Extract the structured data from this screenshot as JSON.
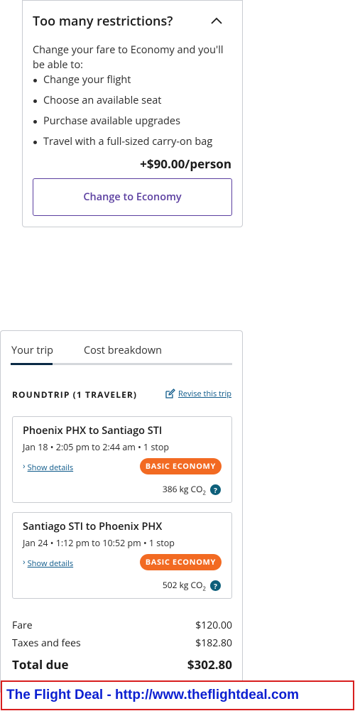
{
  "restrictions": {
    "title": "Too many restrictions?",
    "intro": "Change your fare to Economy and you'll be able to:",
    "items": [
      "Change your flight",
      "Choose an available seat",
      "Purchase available upgrades",
      "Travel with a full-sized carry-on bag"
    ],
    "price": "+$90.00/person",
    "button_label": "Change to Economy"
  },
  "trip": {
    "tabs": [
      {
        "label": "Your trip",
        "active": true
      },
      {
        "label": "Cost breakdown",
        "active": false
      }
    ],
    "trip_type_label": "ROUNDTRIP (1 TRAVELER)",
    "revise_label": "Revise this trip",
    "flights": [
      {
        "route": "Phoenix PHX to Santiago STI",
        "times": "Jan 18 • 2:05 pm to 2:44 am • 1 stop",
        "details_label": "Show details",
        "fare_badge": "BASIC ECONOMY",
        "co2_value": "386 kg CO",
        "co2_sub": "2"
      },
      {
        "route": "Santiago STI to Phoenix PHX",
        "times": "Jan 24 • 1:12 pm to 10:52 pm • 1 stop",
        "details_label": "Show details",
        "fare_badge": "BASIC ECONOMY",
        "co2_value": "502 kg CO",
        "co2_sub": "2"
      }
    ],
    "costs": {
      "fare_label": "Fare",
      "fare_value": "$120.00",
      "taxes_label": "Taxes and fees",
      "taxes_value": "$182.80",
      "total_label": "Total due",
      "total_value": "$302.80"
    }
  },
  "banner": {
    "text": "The Flight Deal - http://www.theflightdeal.com"
  },
  "colors": {
    "accent_purple": "#5b3fa0",
    "badge_orange": "#f26a22",
    "link_blue": "#0e5a8a",
    "tab_active": "#0b2a45",
    "banner_border": "#d81e1e",
    "banner_text": "#0b1fd1"
  },
  "icons": {
    "collapse": "chevron-up-icon",
    "revise": "edit-icon",
    "details": "chevron-right-icon",
    "help": "question-icon"
  }
}
